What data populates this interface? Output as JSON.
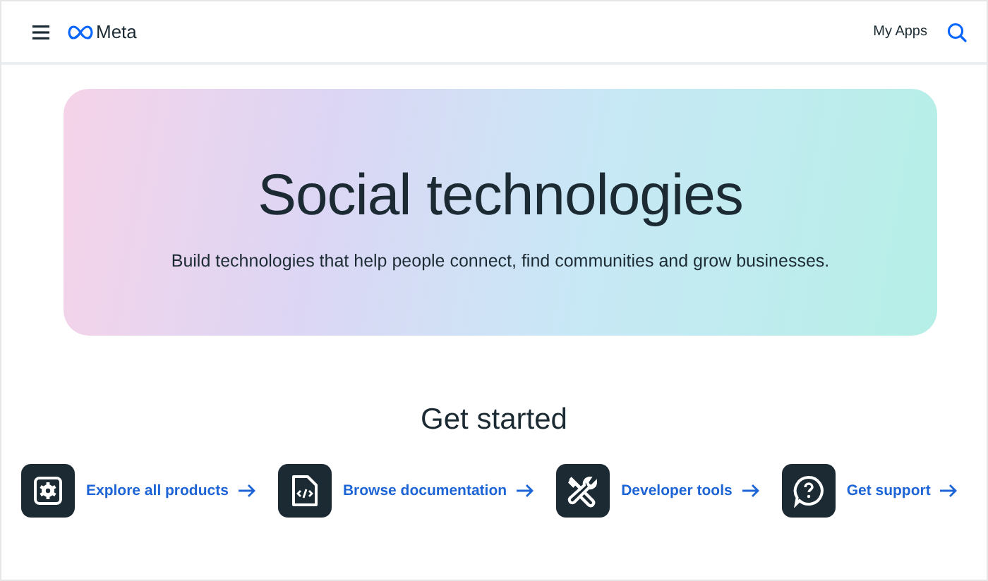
{
  "header": {
    "logo_text": "Meta",
    "nav_link": "My Apps"
  },
  "hero": {
    "title": "Social technologies",
    "subtitle": "Build technologies that help people connect, find communities and grow businesses."
  },
  "get_started": {
    "title": "Get started",
    "links": [
      {
        "kind": "products",
        "label": "Explore all products"
      },
      {
        "kind": "docs",
        "label": "Browse documentation"
      },
      {
        "kind": "tools",
        "label": "Developer tools"
      },
      {
        "kind": "support",
        "label": "Get support"
      }
    ]
  }
}
